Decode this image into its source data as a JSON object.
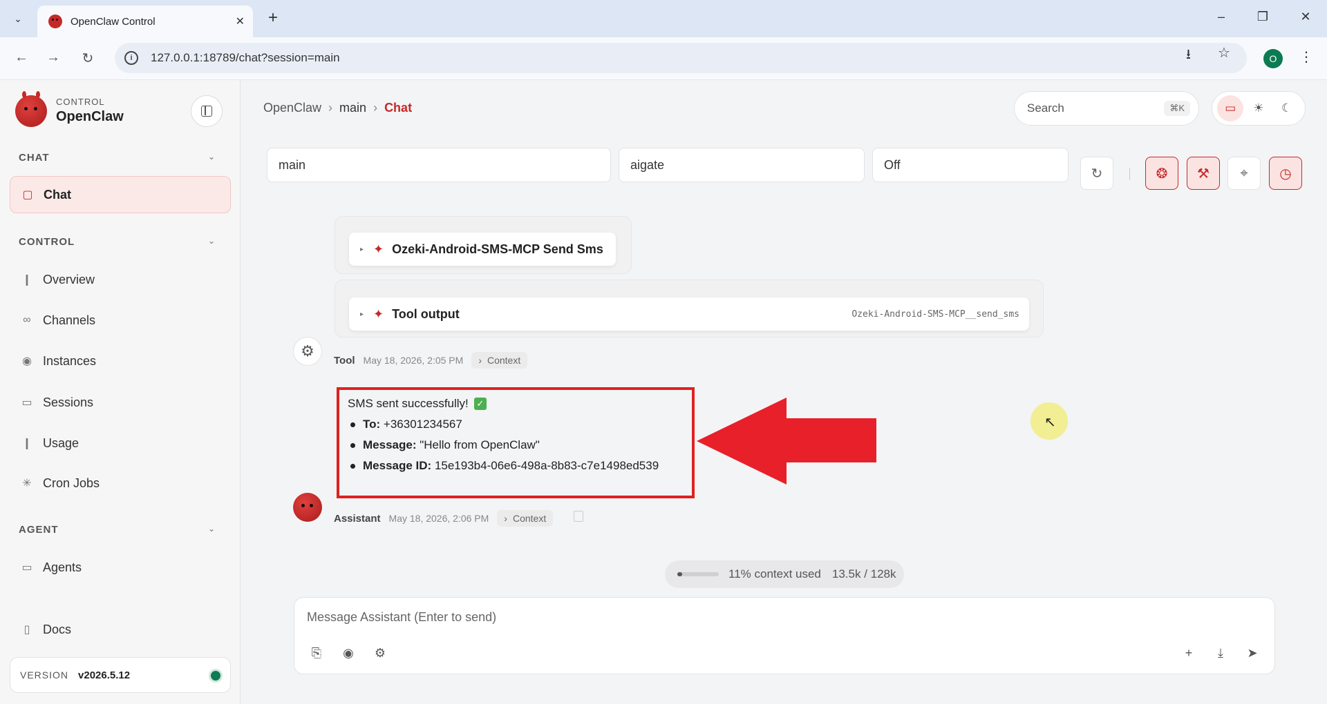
{
  "browser": {
    "tab_title": "OpenClaw Control",
    "url": "127.0.0.1:18789/chat?session=main",
    "profile_initial": "O"
  },
  "sidebar": {
    "brand_kicker": "CONTROL",
    "brand_name": "OpenClaw",
    "sections": {
      "chat": "CHAT",
      "control": "CONTROL",
      "agent": "AGENT"
    },
    "items": [
      {
        "label": "Chat",
        "icon": "message-square-icon",
        "active": true
      },
      {
        "label": "Overview",
        "icon": "bar-chart-icon"
      },
      {
        "label": "Channels",
        "icon": "link-icon"
      },
      {
        "label": "Instances",
        "icon": "broadcast-icon"
      },
      {
        "label": "Sessions",
        "icon": "file-text-icon"
      },
      {
        "label": "Usage",
        "icon": "bar-chart-icon"
      },
      {
        "label": "Cron Jobs",
        "icon": "loader-icon"
      },
      {
        "label": "Agents",
        "icon": "folder-icon"
      },
      {
        "label": "Docs",
        "icon": "book-icon"
      }
    ],
    "version_label": "VERSION",
    "version_value": "v2026.5.12",
    "status_color": "#0f7a55"
  },
  "topbar": {
    "breadcrumb": [
      "OpenClaw",
      "main",
      "Chat"
    ],
    "search_placeholder": "Search",
    "search_shortcut": "⌘K"
  },
  "selectors": {
    "session": "main",
    "model": "aigate",
    "thinking": "Off"
  },
  "tool_cards": [
    {
      "title": "Ozeki-Android-SMS-MCP Send Sms",
      "tag": ""
    },
    {
      "title": "Tool output",
      "tag": "Ozeki-Android-SMS-MCP__send_sms"
    }
  ],
  "tool_meta": {
    "who": "Tool",
    "time": "May 18, 2026, 2:05 PM",
    "context": "Context"
  },
  "message": {
    "line1": "SMS sent successfully!",
    "items": [
      {
        "label": "To:",
        "value": "+36301234567"
      },
      {
        "label": "Message:",
        "value": "\"Hello from OpenClaw\""
      },
      {
        "label": "Message ID:",
        "value": "15e193b4-06e6-498a-8b83-c7e1498ed539"
      }
    ]
  },
  "assistant_meta": {
    "who": "Assistant",
    "time": "May 18, 2026, 2:06 PM",
    "context": "Context"
  },
  "context_usage": {
    "percent_fraction": 0.11,
    "text": "11% context used",
    "count": "13.5k / 128k"
  },
  "composer": {
    "placeholder": "Message Assistant (Enter to send)"
  },
  "colors": {
    "accent": "#c62828",
    "highlight_box": "#e02020",
    "arrow": "#e8202a"
  }
}
